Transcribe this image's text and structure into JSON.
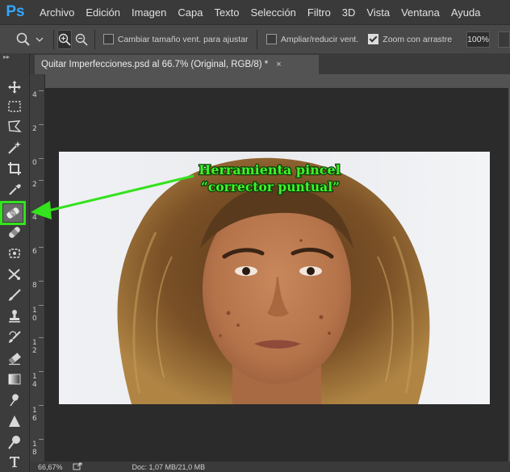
{
  "app": {
    "logo": "Ps"
  },
  "menu": [
    "Archivo",
    "Edición",
    "Imagen",
    "Capa",
    "Texto",
    "Selección",
    "Filtro",
    "3D",
    "Vista",
    "Ventana",
    "Ayuda"
  ],
  "options": {
    "resize_windows_label": "Cambiar tamaño vent. para ajustar",
    "resize_windows_checked": false,
    "zoom_all_label": "Ampliar/reducir vent.",
    "zoom_all_checked": false,
    "scrubby_zoom_label": "Zoom con arrastre",
    "scrubby_zoom_checked": true,
    "zoom_value": "100%"
  },
  "document": {
    "tab_title": "Quitar Imperfecciones.psd al 66.7% (Original, RGB/8) *",
    "close_glyph": "×"
  },
  "ruler_labels": [
    "4",
    "2",
    "0",
    "2",
    "4",
    "6",
    "8",
    "1\n0",
    "1\n2",
    "1\n4",
    "1\n6",
    "1\n8"
  ],
  "status": {
    "zoom": "66,67%",
    "doc_info": "Doc: 1,07 MB/21,0 MB"
  },
  "annotation": {
    "line1": "Herramienta pincel",
    "line2": "“corrector puntual”",
    "color": "#34e21d"
  },
  "toolbar": {
    "tools": [
      "move",
      "marquee",
      "lasso",
      "quick-selection",
      "crop",
      "eyedropper",
      "spot-healing-brush",
      "healing-brush",
      "patch",
      "content-aware-move",
      "brush",
      "clone-stamp",
      "history-brush",
      "eraser",
      "gradient",
      "smudge",
      "path-selection",
      "dodge",
      "type"
    ],
    "selected": "spot-healing-brush"
  }
}
